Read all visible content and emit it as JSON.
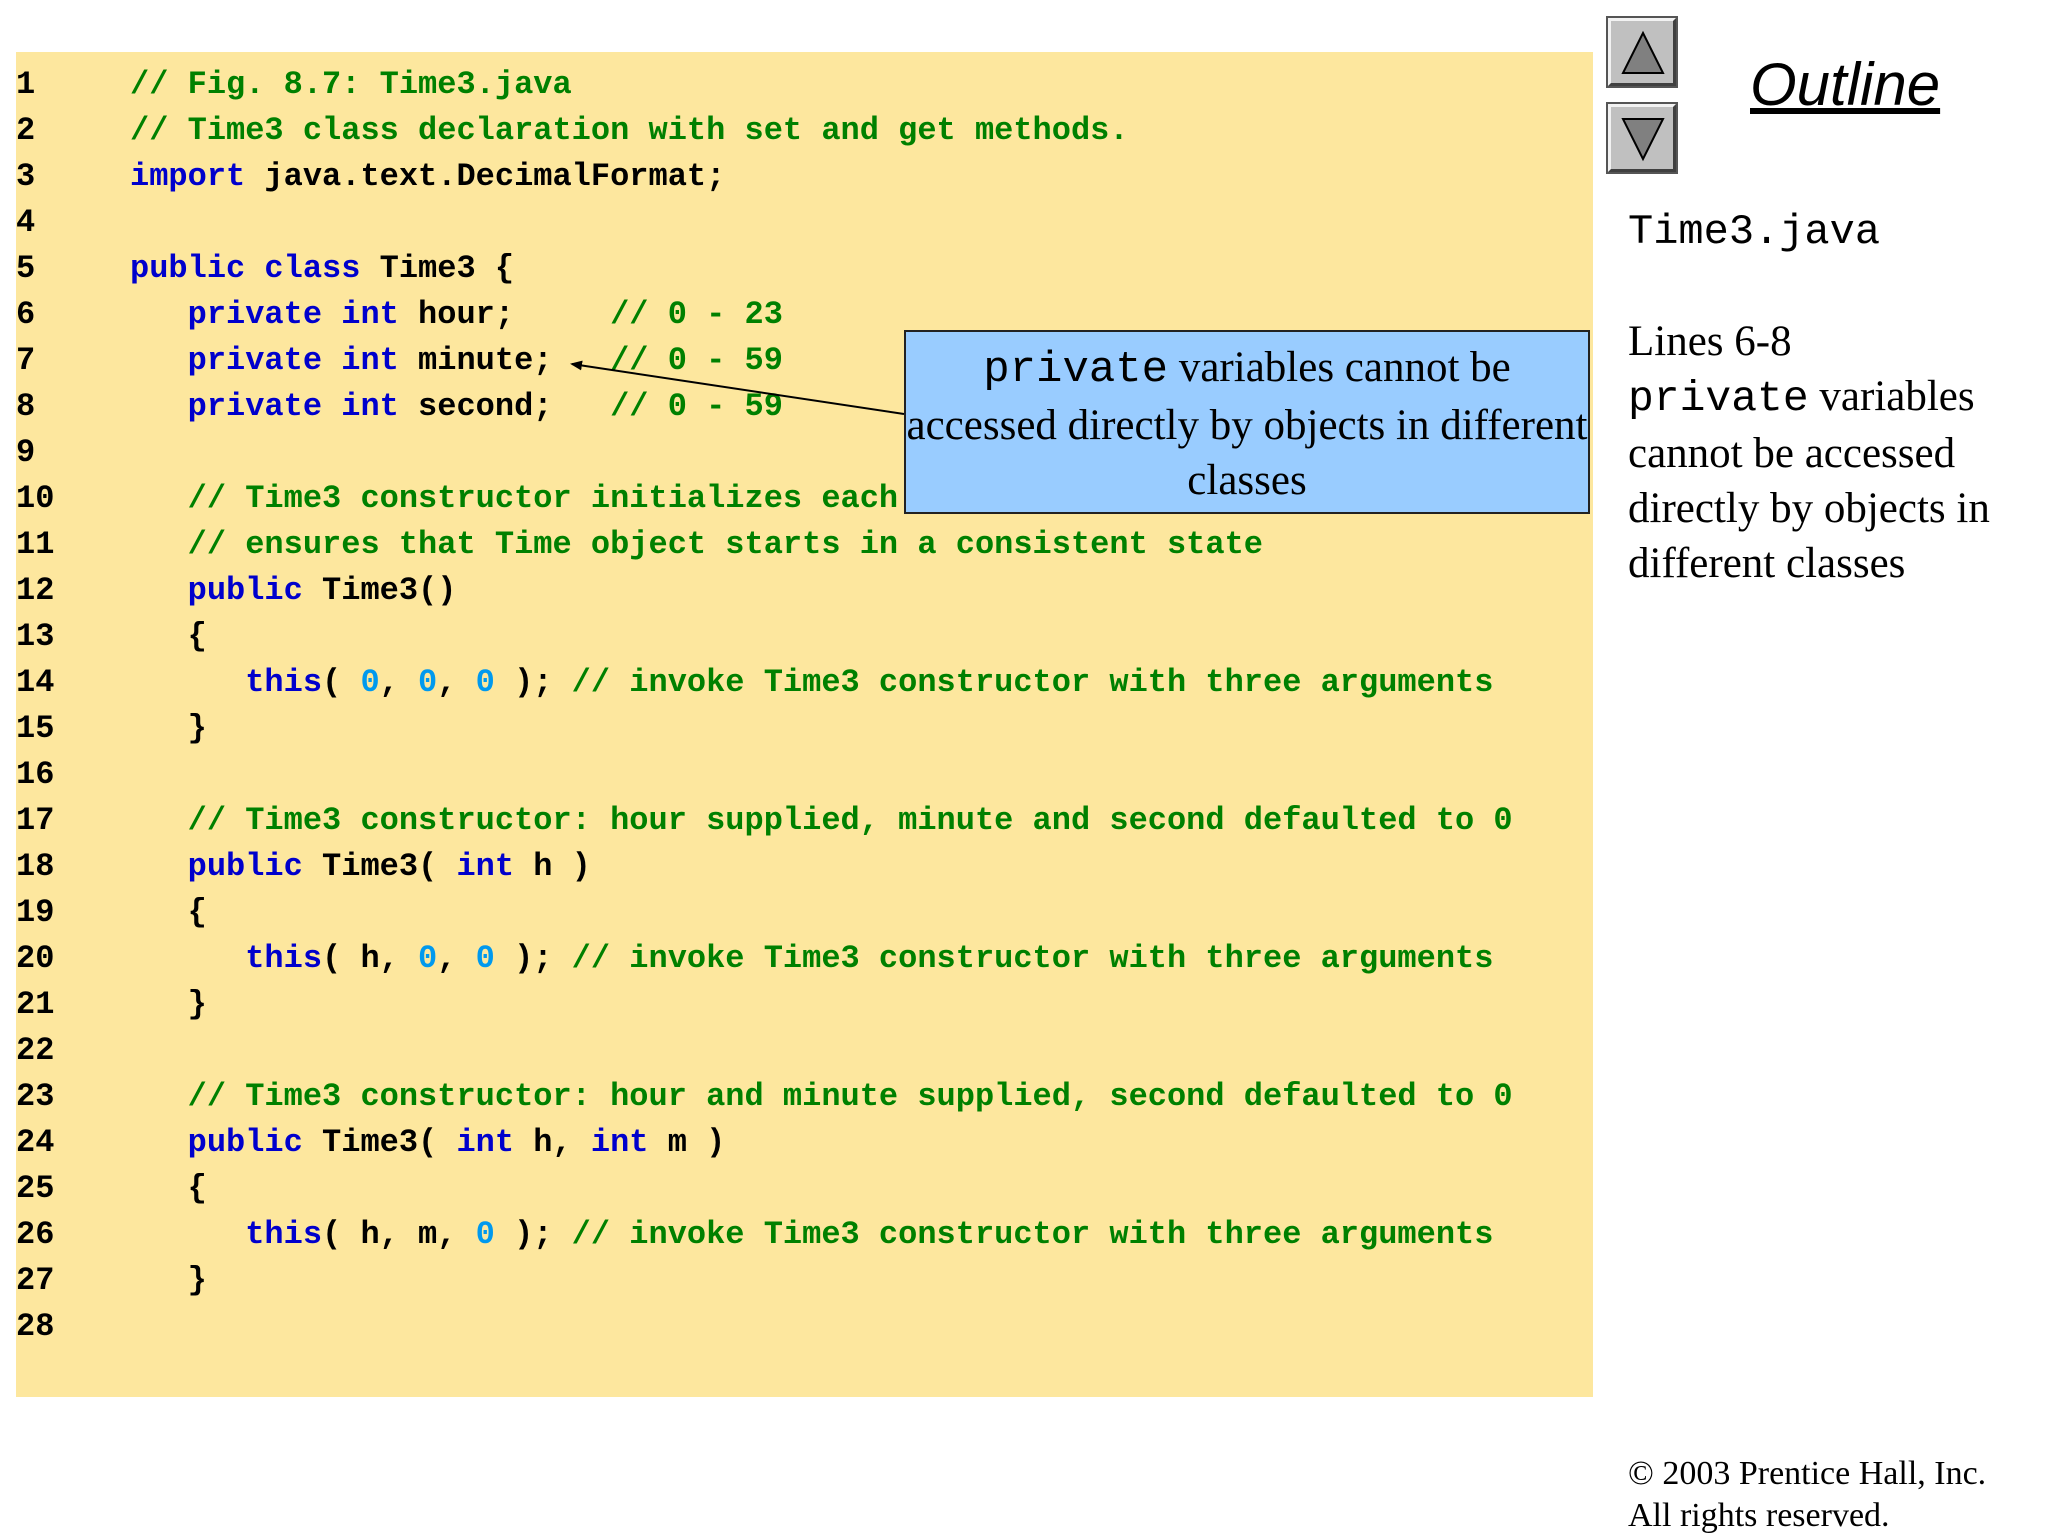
{
  "colors": {
    "panel_bg": "#fde79e",
    "keyword": "#0000cc",
    "comment": "#008000",
    "number": "#0099ee",
    "callout_bg": "#99ccff"
  },
  "code_lines": [
    {
      "num": "1",
      "tokens": [
        {
          "t": "cm",
          "v": "// Fig. 8.7: Time3.java"
        }
      ]
    },
    {
      "num": "2",
      "tokens": [
        {
          "t": "cm",
          "v": "// Time3 class declaration with set and get methods."
        }
      ]
    },
    {
      "num": "3",
      "tokens": [
        {
          "t": "kw",
          "v": "import"
        },
        {
          "t": "tx",
          "v": " java.text.DecimalFormat;"
        }
      ]
    },
    {
      "num": "4",
      "tokens": []
    },
    {
      "num": "5",
      "tokens": [
        {
          "t": "kw",
          "v": "public class"
        },
        {
          "t": "tx",
          "v": " Time3 {"
        }
      ]
    },
    {
      "num": "6",
      "tokens": [
        {
          "t": "tx",
          "v": "   "
        },
        {
          "t": "kw",
          "v": "private int"
        },
        {
          "t": "tx",
          "v": " hour;     "
        },
        {
          "t": "cm",
          "v": "// 0 - 23"
        }
      ]
    },
    {
      "num": "7",
      "tokens": [
        {
          "t": "tx",
          "v": "   "
        },
        {
          "t": "kw",
          "v": "private int"
        },
        {
          "t": "tx",
          "v": " minute;   "
        },
        {
          "t": "cm",
          "v": "// 0 - 59"
        }
      ]
    },
    {
      "num": "8",
      "tokens": [
        {
          "t": "tx",
          "v": "   "
        },
        {
          "t": "kw",
          "v": "private int"
        },
        {
          "t": "tx",
          "v": " second;   "
        },
        {
          "t": "cm",
          "v": "// 0 - 59"
        }
      ]
    },
    {
      "num": "9",
      "tokens": []
    },
    {
      "num": "10",
      "tokens": [
        {
          "t": "tx",
          "v": "   "
        },
        {
          "t": "cm",
          "v": "// Time3 constructor initializes each"
        }
      ]
    },
    {
      "num": "11",
      "tokens": [
        {
          "t": "tx",
          "v": "   "
        },
        {
          "t": "cm",
          "v": "// ensures that Time object starts in a consistent state"
        }
      ]
    },
    {
      "num": "12",
      "tokens": [
        {
          "t": "tx",
          "v": "   "
        },
        {
          "t": "kw",
          "v": "public"
        },
        {
          "t": "tx",
          "v": " Time3()"
        }
      ]
    },
    {
      "num": "13",
      "tokens": [
        {
          "t": "tx",
          "v": "   {"
        }
      ]
    },
    {
      "num": "14",
      "tokens": [
        {
          "t": "tx",
          "v": "      "
        },
        {
          "t": "kw",
          "v": "this"
        },
        {
          "t": "tx",
          "v": "( "
        },
        {
          "t": "nm",
          "v": "0"
        },
        {
          "t": "tx",
          "v": ", "
        },
        {
          "t": "nm",
          "v": "0"
        },
        {
          "t": "tx",
          "v": ", "
        },
        {
          "t": "nm",
          "v": "0"
        },
        {
          "t": "tx",
          "v": " ); "
        },
        {
          "t": "cm",
          "v": "// invoke Time3 constructor with three arguments"
        }
      ]
    },
    {
      "num": "15",
      "tokens": [
        {
          "t": "tx",
          "v": "   }"
        }
      ]
    },
    {
      "num": "16",
      "tokens": []
    },
    {
      "num": "17",
      "tokens": [
        {
          "t": "tx",
          "v": "   "
        },
        {
          "t": "cm",
          "v": "// Time3 constructor: hour supplied, minute and second defaulted to 0"
        }
      ]
    },
    {
      "num": "18",
      "tokens": [
        {
          "t": "tx",
          "v": "   "
        },
        {
          "t": "kw",
          "v": "public"
        },
        {
          "t": "tx",
          "v": " Time3( "
        },
        {
          "t": "kw",
          "v": "int"
        },
        {
          "t": "tx",
          "v": " h )"
        }
      ]
    },
    {
      "num": "19",
      "tokens": [
        {
          "t": "tx",
          "v": "   {"
        }
      ]
    },
    {
      "num": "20",
      "tokens": [
        {
          "t": "tx",
          "v": "      "
        },
        {
          "t": "kw",
          "v": "this"
        },
        {
          "t": "tx",
          "v": "( h, "
        },
        {
          "t": "nm",
          "v": "0"
        },
        {
          "t": "tx",
          "v": ", "
        },
        {
          "t": "nm",
          "v": "0"
        },
        {
          "t": "tx",
          "v": " ); "
        },
        {
          "t": "cm",
          "v": "// invoke Time3 constructor with three arguments"
        }
      ]
    },
    {
      "num": "21",
      "tokens": [
        {
          "t": "tx",
          "v": "   }"
        }
      ]
    },
    {
      "num": "22",
      "tokens": []
    },
    {
      "num": "23",
      "tokens": [
        {
          "t": "tx",
          "v": "   "
        },
        {
          "t": "cm",
          "v": "// Time3 constructor: hour and minute supplied, second defaulted to 0"
        }
      ]
    },
    {
      "num": "24",
      "tokens": [
        {
          "t": "tx",
          "v": "   "
        },
        {
          "t": "kw",
          "v": "public"
        },
        {
          "t": "tx",
          "v": " Time3( "
        },
        {
          "t": "kw",
          "v": "int"
        },
        {
          "t": "tx",
          "v": " h, "
        },
        {
          "t": "kw",
          "v": "int"
        },
        {
          "t": "tx",
          "v": " m )"
        }
      ]
    },
    {
      "num": "25",
      "tokens": [
        {
          "t": "tx",
          "v": "   {"
        }
      ]
    },
    {
      "num": "26",
      "tokens": [
        {
          "t": "tx",
          "v": "      "
        },
        {
          "t": "kw",
          "v": "this"
        },
        {
          "t": "tx",
          "v": "( h, m, "
        },
        {
          "t": "nm",
          "v": "0"
        },
        {
          "t": "tx",
          "v": " ); "
        },
        {
          "t": "cm",
          "v": "// invoke Time3 constructor with three arguments"
        }
      ]
    },
    {
      "num": "27",
      "tokens": [
        {
          "t": "tx",
          "v": "   }"
        }
      ]
    },
    {
      "num": "28",
      "tokens": []
    }
  ],
  "callout": {
    "mono": "private",
    "text": " variables cannot be accessed directly by objects in different classes"
  },
  "nav": {
    "up_icon": "triangle-up-icon",
    "down_icon": "triangle-down-icon"
  },
  "outline": {
    "title": "Outline",
    "filename": "Time3.java",
    "note_lines": "Lines 6-8",
    "note_mono": "private",
    "note_text": " variables cannot be accessed directly by objects in different classes"
  },
  "copyright": {
    "line1": "© 2003 Prentice Hall, Inc.",
    "line2": "All rights reserved."
  }
}
